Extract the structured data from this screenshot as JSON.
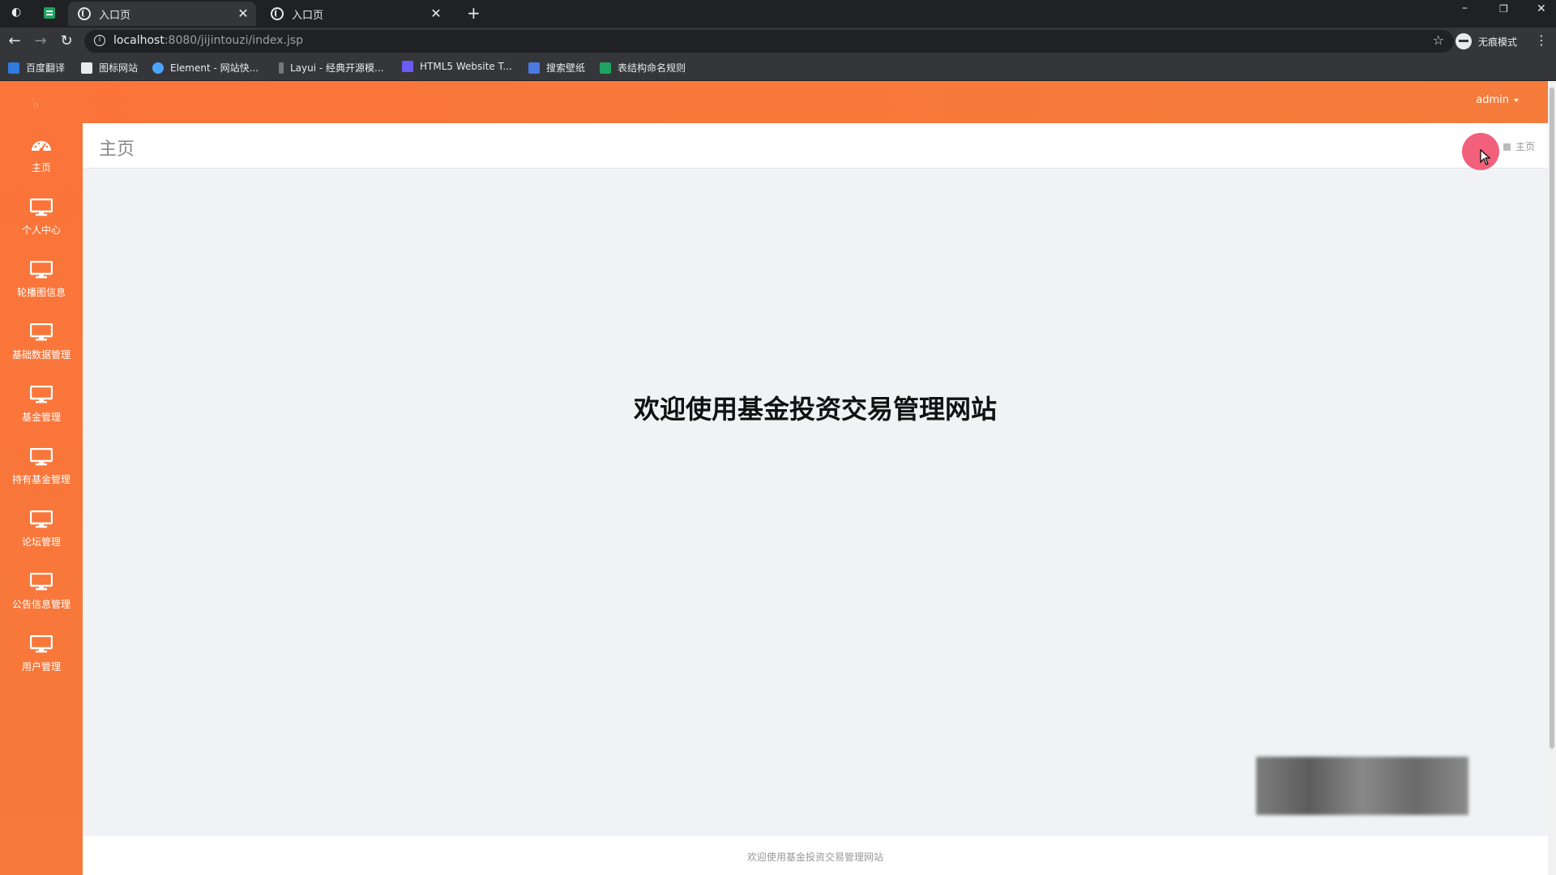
{
  "browser": {
    "tabs": [
      {
        "title": "入口页"
      },
      {
        "title": "入口页"
      }
    ],
    "new_tab": "+",
    "close_glyph": "✕",
    "url_host": "localhost",
    "url_rest": ":8080/jijintouzi/index.jsp",
    "incognito_label": "无痕模式",
    "bookmarks": [
      {
        "label": "百度翻译",
        "color": "#2f7be0"
      },
      {
        "label": "图标网站",
        "color": "#e8eaed"
      },
      {
        "label": "Element - 网站快...",
        "color": "#4aa3ff"
      },
      {
        "label": "Layui - 经典开源模...",
        "color": "#777"
      },
      {
        "label": "HTML5 Website T...",
        "color": "#6a5cf0"
      },
      {
        "label": "搜索壁纸",
        "color": "#4a7ae0"
      },
      {
        "label": "表结构命名规则",
        "color": "#1ea362"
      }
    ]
  },
  "app": {
    "logo": "♭",
    "user": "admin",
    "sidebar": [
      {
        "label": "主页",
        "icon": "dashboard-icon"
      },
      {
        "label": "个人中心",
        "icon": "monitor-icon"
      },
      {
        "label": "轮播图信息",
        "icon": "monitor-icon"
      },
      {
        "label": "基础数据管理",
        "icon": "monitor-icon"
      },
      {
        "label": "基金管理",
        "icon": "monitor-icon"
      },
      {
        "label": "持有基金管理",
        "icon": "monitor-icon"
      },
      {
        "label": "论坛管理",
        "icon": "monitor-icon"
      },
      {
        "label": "公告信息管理",
        "icon": "monitor-icon"
      },
      {
        "label": "用户管理",
        "icon": "monitor-icon"
      }
    ],
    "page_title": "主页",
    "breadcrumb": "主页",
    "welcome": "欢迎使用基金投资交易管理网站",
    "footer": "欢迎使用基金投资交易管理网站"
  },
  "colors": {
    "accent": "#fb7439",
    "background": "#f0f2f5"
  }
}
